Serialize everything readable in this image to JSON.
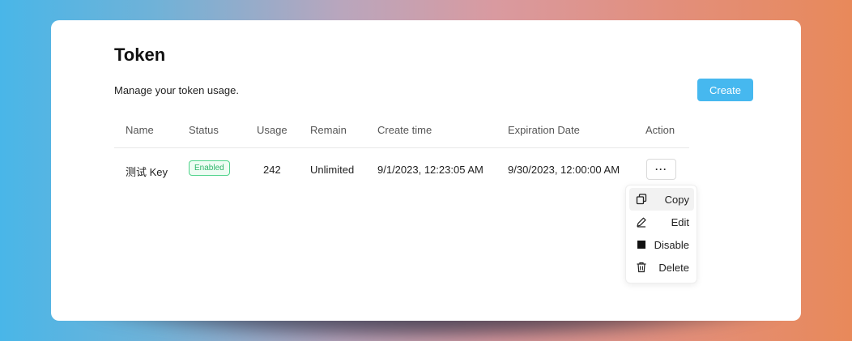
{
  "page": {
    "title": "Token",
    "subtitle": "Manage your token usage.",
    "create_label": "Create"
  },
  "table": {
    "columns": [
      "Name",
      "Status",
      "Usage",
      "Remain",
      "Create time",
      "Expiration Date",
      "Action"
    ],
    "rows": [
      {
        "name": "测试 Key",
        "status": "Enabled",
        "usage": "242",
        "remain": "Unlimited",
        "create_time": "9/1/2023, 12:23:05 AM",
        "expiration_date": "9/30/2023, 12:00:00 AM",
        "action_label": "···"
      }
    ]
  },
  "menu": {
    "items": [
      {
        "label": "Copy",
        "icon": "copy-icon"
      },
      {
        "label": "Edit",
        "icon": "pen-icon"
      },
      {
        "label": "Disable",
        "icon": "stop-icon"
      },
      {
        "label": "Delete",
        "icon": "trash-icon"
      }
    ]
  },
  "colors": {
    "accent": "#46b8ef",
    "enabled_badge": "#2fb56b"
  }
}
